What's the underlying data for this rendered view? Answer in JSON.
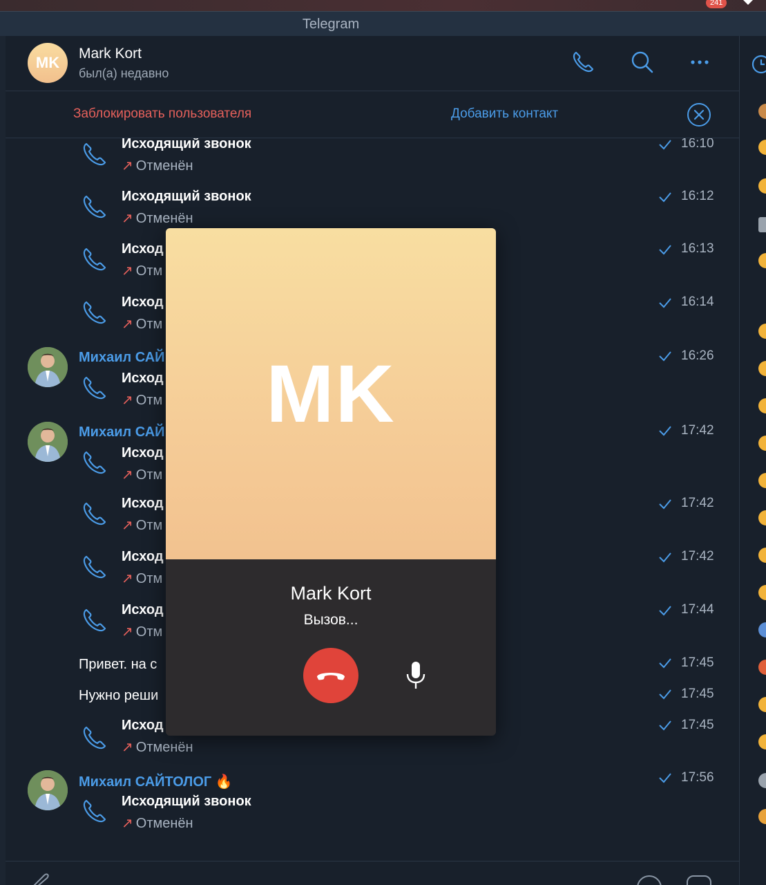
{
  "menubar": {
    "badge": "241"
  },
  "window": {
    "title": "Telegram"
  },
  "header": {
    "avatar_initials": "MK",
    "name": "Mark Kort",
    "status": "был(а) недавно"
  },
  "actionbar": {
    "block_label": "Заблокировать пользователя",
    "add_contact_label": "Добавить контакт"
  },
  "messages": [
    {
      "title": "Исходящий звонок",
      "status": "Отменён",
      "time": "16:10"
    },
    {
      "title": "Исходящий звонок",
      "status": "Отменён",
      "time": "16:12"
    },
    {
      "title": "Исход",
      "status": "Отм",
      "time": "16:13"
    },
    {
      "title": "Исход",
      "status": "Отм",
      "time": "16:14"
    },
    {
      "sender": "Михаил САЙ",
      "title": "Исход",
      "status": "Отм",
      "time": "16:26"
    },
    {
      "sender": "Михаил САЙ",
      "title": "Исход",
      "status": "Отм",
      "time": "17:42"
    },
    {
      "title": "Исход",
      "status": "Отм",
      "time": "17:42"
    },
    {
      "title": "Исход",
      "status": "Отм",
      "time": "17:42"
    },
    {
      "title": "Исход",
      "status": "Отм",
      "time": "17:44"
    },
    {
      "text": "Привет. на с",
      "time": "17:45"
    },
    {
      "text": "Нужно реши",
      "time": "17:45"
    },
    {
      "title": "Исход",
      "status": "Отменён",
      "time": "17:45"
    },
    {
      "sender": "Михаил САЙТОЛОГ 🔥",
      "title": "Исходящий звонок",
      "status": "Отменён",
      "time": "17:56"
    }
  ],
  "call": {
    "initials": "MK",
    "name": "Mark Kort",
    "status": "Вызов..."
  },
  "colors": {
    "accent": "#4b9ce8",
    "danger": "#e5605b",
    "background": "#18202b",
    "call_panel": "#2d2b2d",
    "hangup": "#e0443a"
  }
}
